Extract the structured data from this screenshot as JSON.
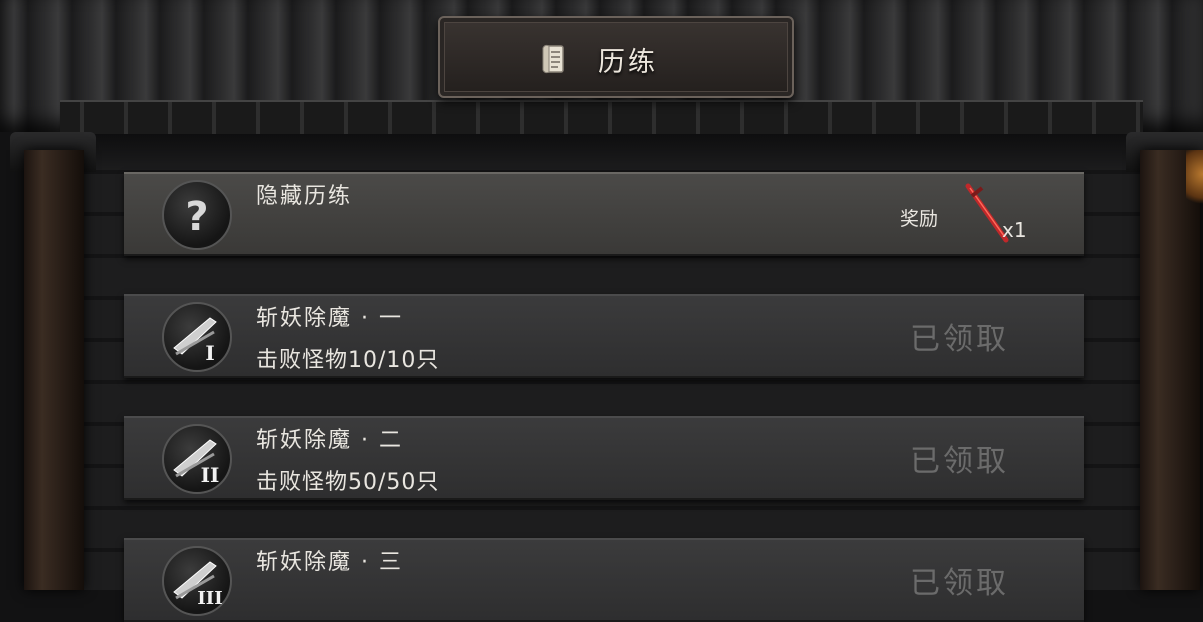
{
  "header": {
    "title": "历练",
    "icon": "scroll-icon"
  },
  "quests": [
    {
      "name": "隐藏历练",
      "badge_icon": "question-mark-icon",
      "reward_label": "奖励",
      "reward_icon": "red-sword-icon",
      "reward_qty": "x1"
    },
    {
      "name": "斩妖除魔 · 一",
      "progress": "击败怪物10/10只",
      "badge_icon": "sword-rank-1-icon",
      "badge_numeral": "I",
      "status": "已领取"
    },
    {
      "name": "斩妖除魔 · 二",
      "progress": "击败怪物50/50只",
      "badge_icon": "sword-rank-2-icon",
      "badge_numeral": "II",
      "status": "已领取"
    },
    {
      "name": "斩妖除魔 · 三",
      "badge_icon": "sword-rank-3-icon",
      "badge_numeral": "III",
      "status": "已领取"
    }
  ],
  "colors": {
    "title_text": "#ece6dc",
    "row_text": "#e9e6e0",
    "claimed_text": "#6b6b6b",
    "reward_accent": "#c0282a"
  }
}
